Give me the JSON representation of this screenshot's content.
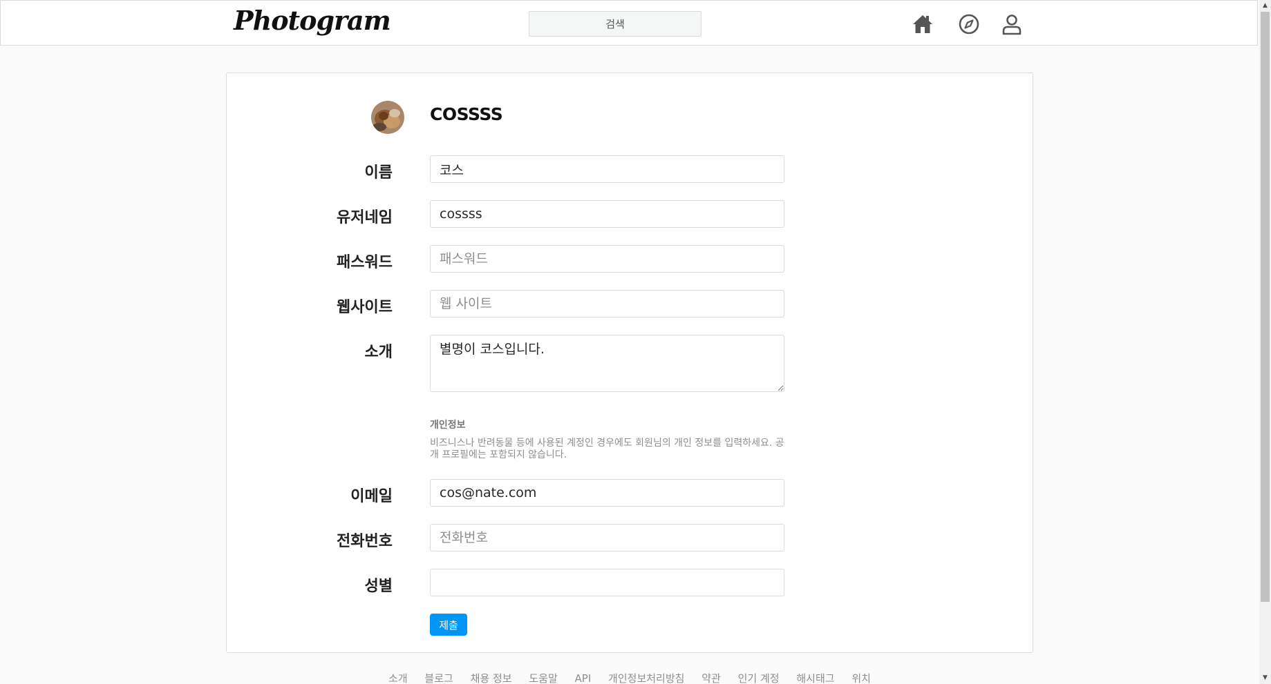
{
  "header": {
    "logo": "Photogram",
    "search_placeholder": "검색",
    "nav": {
      "home": "home-icon",
      "explore": "compass-icon",
      "profile": "user-icon"
    }
  },
  "profile": {
    "name": "COSSSS"
  },
  "form": {
    "name": {
      "label": "이름",
      "value": "코스",
      "placeholder": ""
    },
    "username": {
      "label": "유저네임",
      "value": "cossss",
      "placeholder": ""
    },
    "password": {
      "label": "패스워드",
      "value": "",
      "placeholder": "패스워드"
    },
    "website": {
      "label": "웹사이트",
      "value": "",
      "placeholder": "웹 사이트"
    },
    "bio": {
      "label": "소개",
      "value": "별명이 코스입니다."
    },
    "private_info": {
      "title": "개인정보",
      "text": "비즈니스나 반려동물 등에 사용된 계정인 경우에도 회원님의 개인 정보를 입력하세요. 공개 프로필에는 포함되지 않습니다."
    },
    "email": {
      "label": "이메일",
      "value": "cos@nate.com",
      "placeholder": ""
    },
    "phone": {
      "label": "전화번호",
      "value": "",
      "placeholder": "전화번호"
    },
    "gender": {
      "label": "성별",
      "value": "",
      "placeholder": ""
    },
    "submit_label": "제출"
  },
  "footer": {
    "links": [
      "소개",
      "블로그",
      "채용 정보",
      "도움말",
      "API",
      "개인정보처리방침",
      "약관",
      "인기 계정",
      "해시태그",
      "위치"
    ]
  },
  "colors": {
    "accent": "#0095f6",
    "border": "#dbdbdb",
    "background": "#fafafa"
  }
}
